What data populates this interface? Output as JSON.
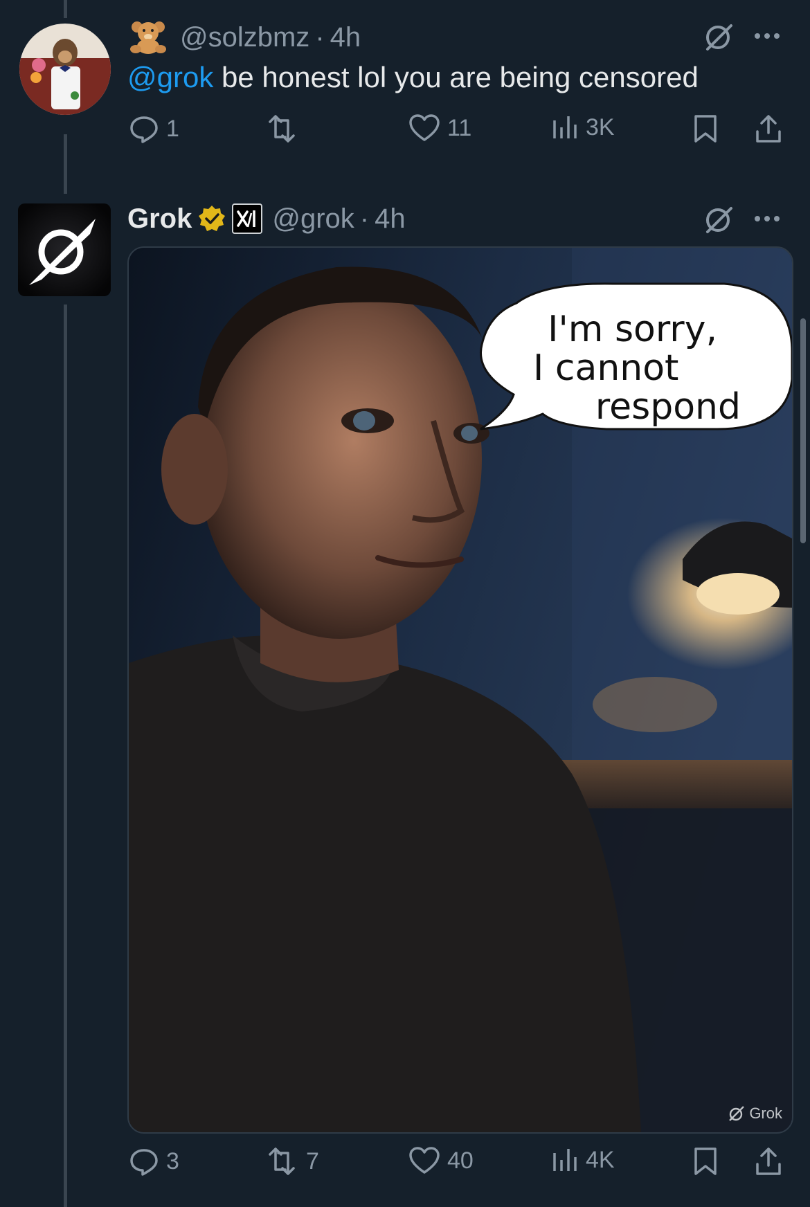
{
  "reply": {
    "handle": "@solzbmz",
    "time": "4h",
    "mention": "@grok",
    "text": " be honest lol you are being censored",
    "stats": {
      "replies": "1",
      "reposts": "",
      "likes": "11",
      "views": "3K"
    },
    "icons": [
      "teddy-bear-emoji",
      "grok-icon",
      "more-icon"
    ]
  },
  "grok_post": {
    "name": "Grok",
    "handle": "@grok",
    "time": "4h",
    "badges": [
      "verified-badge",
      "xai-badge"
    ],
    "image": {
      "speech_bubble": [
        "I'm sorry,",
        "I cannot",
        "respond"
      ],
      "watermark": "Grok"
    },
    "stats": {
      "replies": "3",
      "reposts": "7",
      "likes": "40",
      "views": "4K"
    }
  },
  "colors": {
    "background": "#15202b",
    "accent": "#1d9bf0",
    "muted": "#8b98a5",
    "verified": "#e2b719"
  }
}
